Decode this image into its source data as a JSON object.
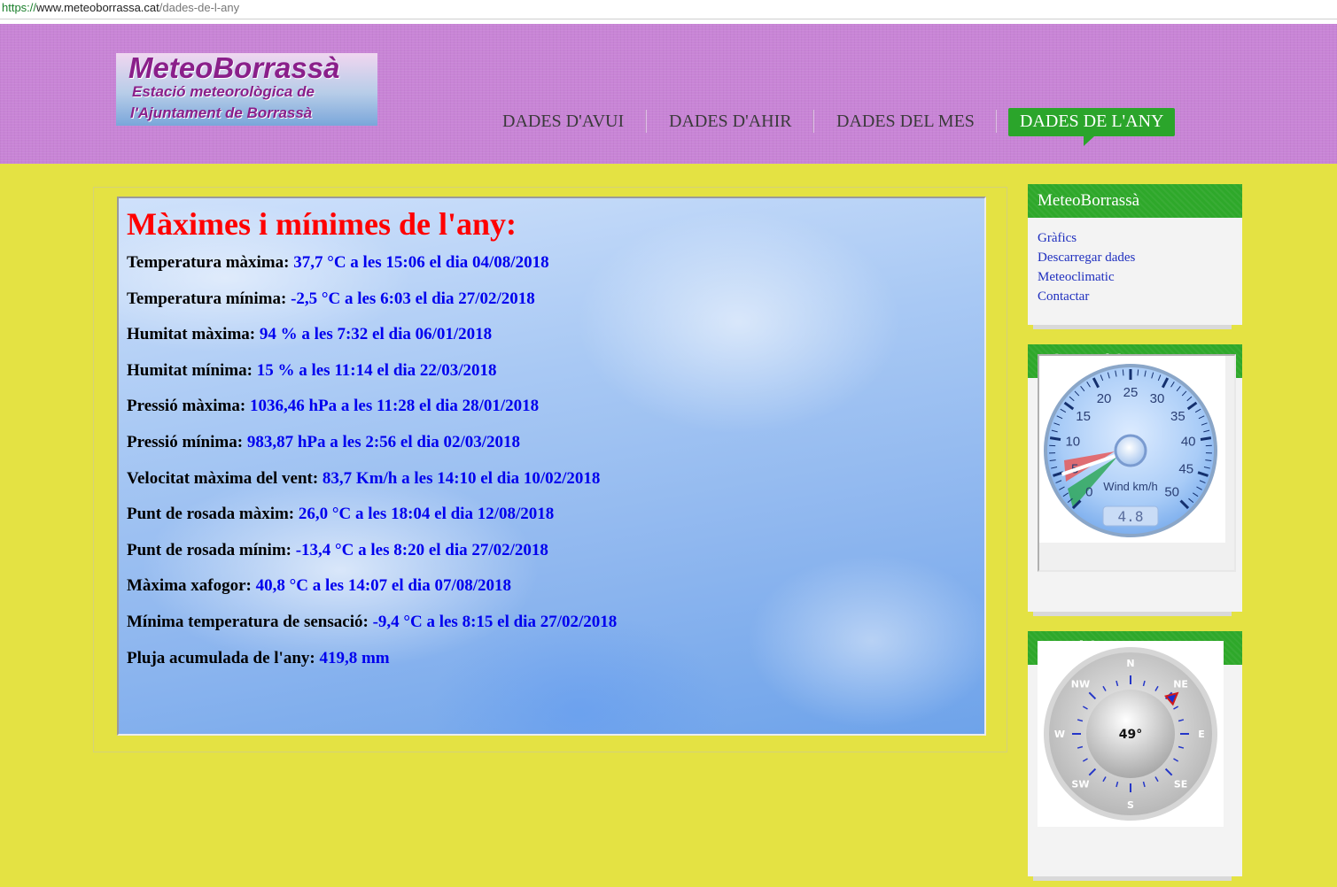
{
  "browser": {
    "url_scheme": "https://",
    "url_host": "www.meteoborrassa.cat",
    "url_path": "/dades-de-l-any"
  },
  "logo": {
    "title": "MeteoBorrassà",
    "line1": "Estació meteorològica de",
    "line2": "l'Ajuntament de Borrassà"
  },
  "nav": {
    "items": [
      {
        "label": "DADES D'AVUI"
      },
      {
        "label": "DADES D'AHIR"
      },
      {
        "label": "DADES DEL MES"
      },
      {
        "label": "DADES DE L'ANY"
      }
    ],
    "active_index": 3,
    "active_color": "#2ba52b"
  },
  "main": {
    "title": "Màximes i mínimes de l'any:",
    "stats": [
      {
        "label": "Temperatura màxima:",
        "value": "37,7 °C a les 15:06 el dia 04/08/2018"
      },
      {
        "label": "Temperatura mínima:",
        "value": "-2,5 °C a les 6:03 el dia 27/02/2018"
      },
      {
        "label": "Humitat màxima:",
        "value": "94 % a les 7:32 el dia 06/01/2018"
      },
      {
        "label": "Humitat mínima:",
        "value": "15 % a les 11:14 el dia 22/03/2018"
      },
      {
        "label": "Pressió màxima:",
        "value": "1036,46 hPa a les 11:28 el dia 28/01/2018"
      },
      {
        "label": "Pressió mínima:",
        "value": "983,87 hPa a les 2:56 el dia 02/03/2018"
      },
      {
        "label": "Velocitat màxima del vent:",
        "value": "83,7 Km/h a les 14:10 el dia 10/02/2018"
      },
      {
        "label": "Punt de rosada màxim:",
        "value": "26,0 °C a les 18:04 el dia 12/08/2018"
      },
      {
        "label": "Punt de rosada mínim:",
        "value": "-13,4 °C a les 8:20 el dia 27/02/2018"
      },
      {
        "label": "Màxima xafogor:",
        "value": "40,8 °C a les 14:07 el dia 07/08/2018"
      },
      {
        "label": "Mínima temperatura de sensació:",
        "value": "-9,4 °C a les 8:15 el dia 27/02/2018"
      },
      {
        "label": "Pluja acumulada de l'any:",
        "value": "419,8 mm"
      }
    ]
  },
  "sidebar": {
    "links_widget": {
      "title": "MeteoBorrassà",
      "links": [
        "Gràfics",
        "Descarregar dades",
        "Meteoclimatic",
        "Contactar"
      ]
    },
    "wind_widget": {
      "title": "Velocitat del vent",
      "gauge_unit": "Wind km/h",
      "gauge_value": "4.8",
      "gauge_min": 0,
      "gauge_max": 50,
      "ticks": [
        "0",
        "5",
        "10",
        "15",
        "20",
        "25",
        "30",
        "35",
        "40",
        "45",
        "50"
      ]
    },
    "rose_widget": {
      "title": "Rosa dels vents",
      "bearing_text": "49°",
      "bearing": 49,
      "directions": [
        "N",
        "NE",
        "E",
        "SE",
        "S",
        "SW",
        "W",
        "NW"
      ]
    }
  }
}
